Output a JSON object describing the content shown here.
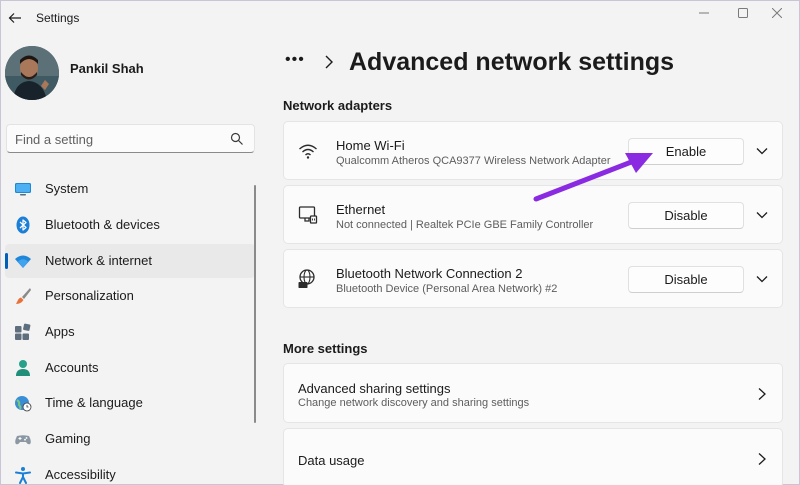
{
  "window": {
    "title": "Settings"
  },
  "profile": {
    "name": "Pankil Shah"
  },
  "search": {
    "placeholder": "Find a setting"
  },
  "sidebar": {
    "items": [
      {
        "label": "System",
        "icon": "monitor-icon",
        "active": false
      },
      {
        "label": "Bluetooth & devices",
        "icon": "bluetooth-icon",
        "active": false
      },
      {
        "label": "Network & internet",
        "icon": "wifi-icon",
        "active": true
      },
      {
        "label": "Personalization",
        "icon": "brush-icon",
        "active": false
      },
      {
        "label": "Apps",
        "icon": "apps-icon",
        "active": false
      },
      {
        "label": "Accounts",
        "icon": "person-icon",
        "active": false
      },
      {
        "label": "Time & language",
        "icon": "globe-clock-icon",
        "active": false
      },
      {
        "label": "Gaming",
        "icon": "gamepad-icon",
        "active": false
      },
      {
        "label": "Accessibility",
        "icon": "accessibility-icon",
        "active": false
      }
    ]
  },
  "breadcrumb": {
    "more": "•••",
    "title": "Advanced network settings"
  },
  "sections": {
    "adapters_heading": "Network adapters",
    "more_heading": "More settings"
  },
  "adapters": [
    {
      "name": "Home Wi-Fi",
      "description": "Qualcomm Atheros QCA9377 Wireless Network Adapter",
      "button": "Enable",
      "icon": "wifi-icon"
    },
    {
      "name": "Ethernet",
      "description": "Not connected | Realtek PCIe GBE Family Controller",
      "button": "Disable",
      "icon": "ethernet-icon"
    },
    {
      "name": "Bluetooth Network Connection 2",
      "description": "Bluetooth Device (Personal Area Network) #2",
      "button": "Disable",
      "icon": "network-globe-icon"
    }
  ],
  "more_settings": [
    {
      "title": "Advanced sharing settings",
      "description": "Change network discovery and sharing settings"
    },
    {
      "title": "Data usage",
      "description": ""
    }
  ],
  "colors": {
    "accent": "#005fb8",
    "annotation_arrow": "#8a2be2"
  }
}
